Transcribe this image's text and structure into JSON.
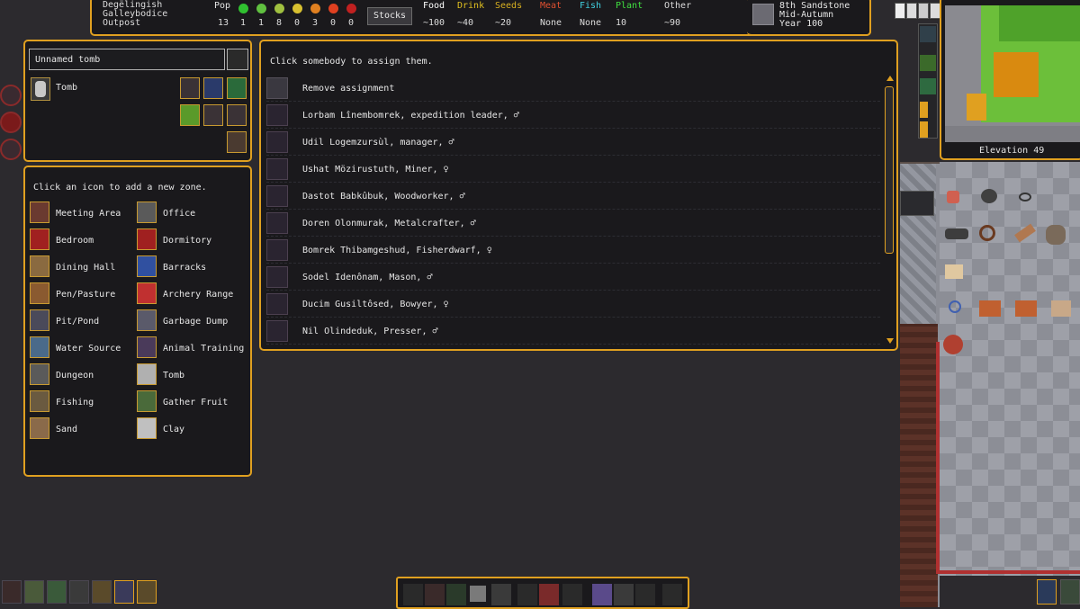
{
  "fortress": {
    "name1": "Degëlingish",
    "name2": "Galleybodice",
    "type": "Outpost"
  },
  "pop": {
    "label": "Pop",
    "total": "13",
    "moods": [
      "1",
      "1",
      "8",
      "0",
      "3",
      "0",
      "0"
    ]
  },
  "stocks_label": "Stocks",
  "resources": [
    {
      "label": "Food",
      "value": "~100",
      "color": "#ffffff"
    },
    {
      "label": "Drink",
      "value": "~40",
      "color": "#e0c020"
    },
    {
      "label": "Seeds",
      "value": "~20",
      "color": "#d8b020"
    },
    {
      "label": "Meat",
      "value": "None",
      "color": "#e05030"
    },
    {
      "label": "Fish",
      "value": "None",
      "color": "#40d0e0"
    },
    {
      "label": "Plant",
      "value": "10",
      "color": "#40e040"
    },
    {
      "label": "Other",
      "value": "~90",
      "color": "#dcdcdc"
    }
  ],
  "date": {
    "day": "8th Sandstone",
    "season": "Mid-Autumn",
    "year": "Year 100"
  },
  "minimap": {
    "elevation": "Elevation 49"
  },
  "tomb": {
    "name": "Unnamed tomb",
    "type": "Tomb"
  },
  "zones": {
    "hint": "Click an icon to add a new zone.",
    "left": [
      "Meeting Area",
      "Bedroom",
      "Dining Hall",
      "Pen/Pasture",
      "Pit/Pond",
      "Water Source",
      "Dungeon",
      "Fishing",
      "Sand"
    ],
    "right": [
      "Office",
      "Dormitory",
      "Barracks",
      "Archery Range",
      "Garbage Dump",
      "Animal Training",
      "Tomb",
      "Gather Fruit",
      "Clay"
    ]
  },
  "assign": {
    "hint": "Click somebody to assign them.",
    "rows": [
      "Remove assignment",
      "Lorbam Lînembomrek, expedition leader, ♂",
      "Udil Logemzursùl, manager, ♂",
      "Ushat Mözirustuth, Miner, ♀",
      "Dastot Babkûbuk, Woodworker, ♂",
      "Doren Olonmurak, Metalcrafter, ♂",
      "Bomrek Thibamgeshud, Fisherdwarf, ♀",
      "Sodel Idenônam, Mason, ♂",
      "Ducim Gusiltôsed, Bowyer, ♀",
      "Nil Olindeduk, Presser, ♂"
    ]
  },
  "colors": {
    "accent": "#e0a020",
    "panel": "#1a191c",
    "background": "#2c2a2e"
  }
}
